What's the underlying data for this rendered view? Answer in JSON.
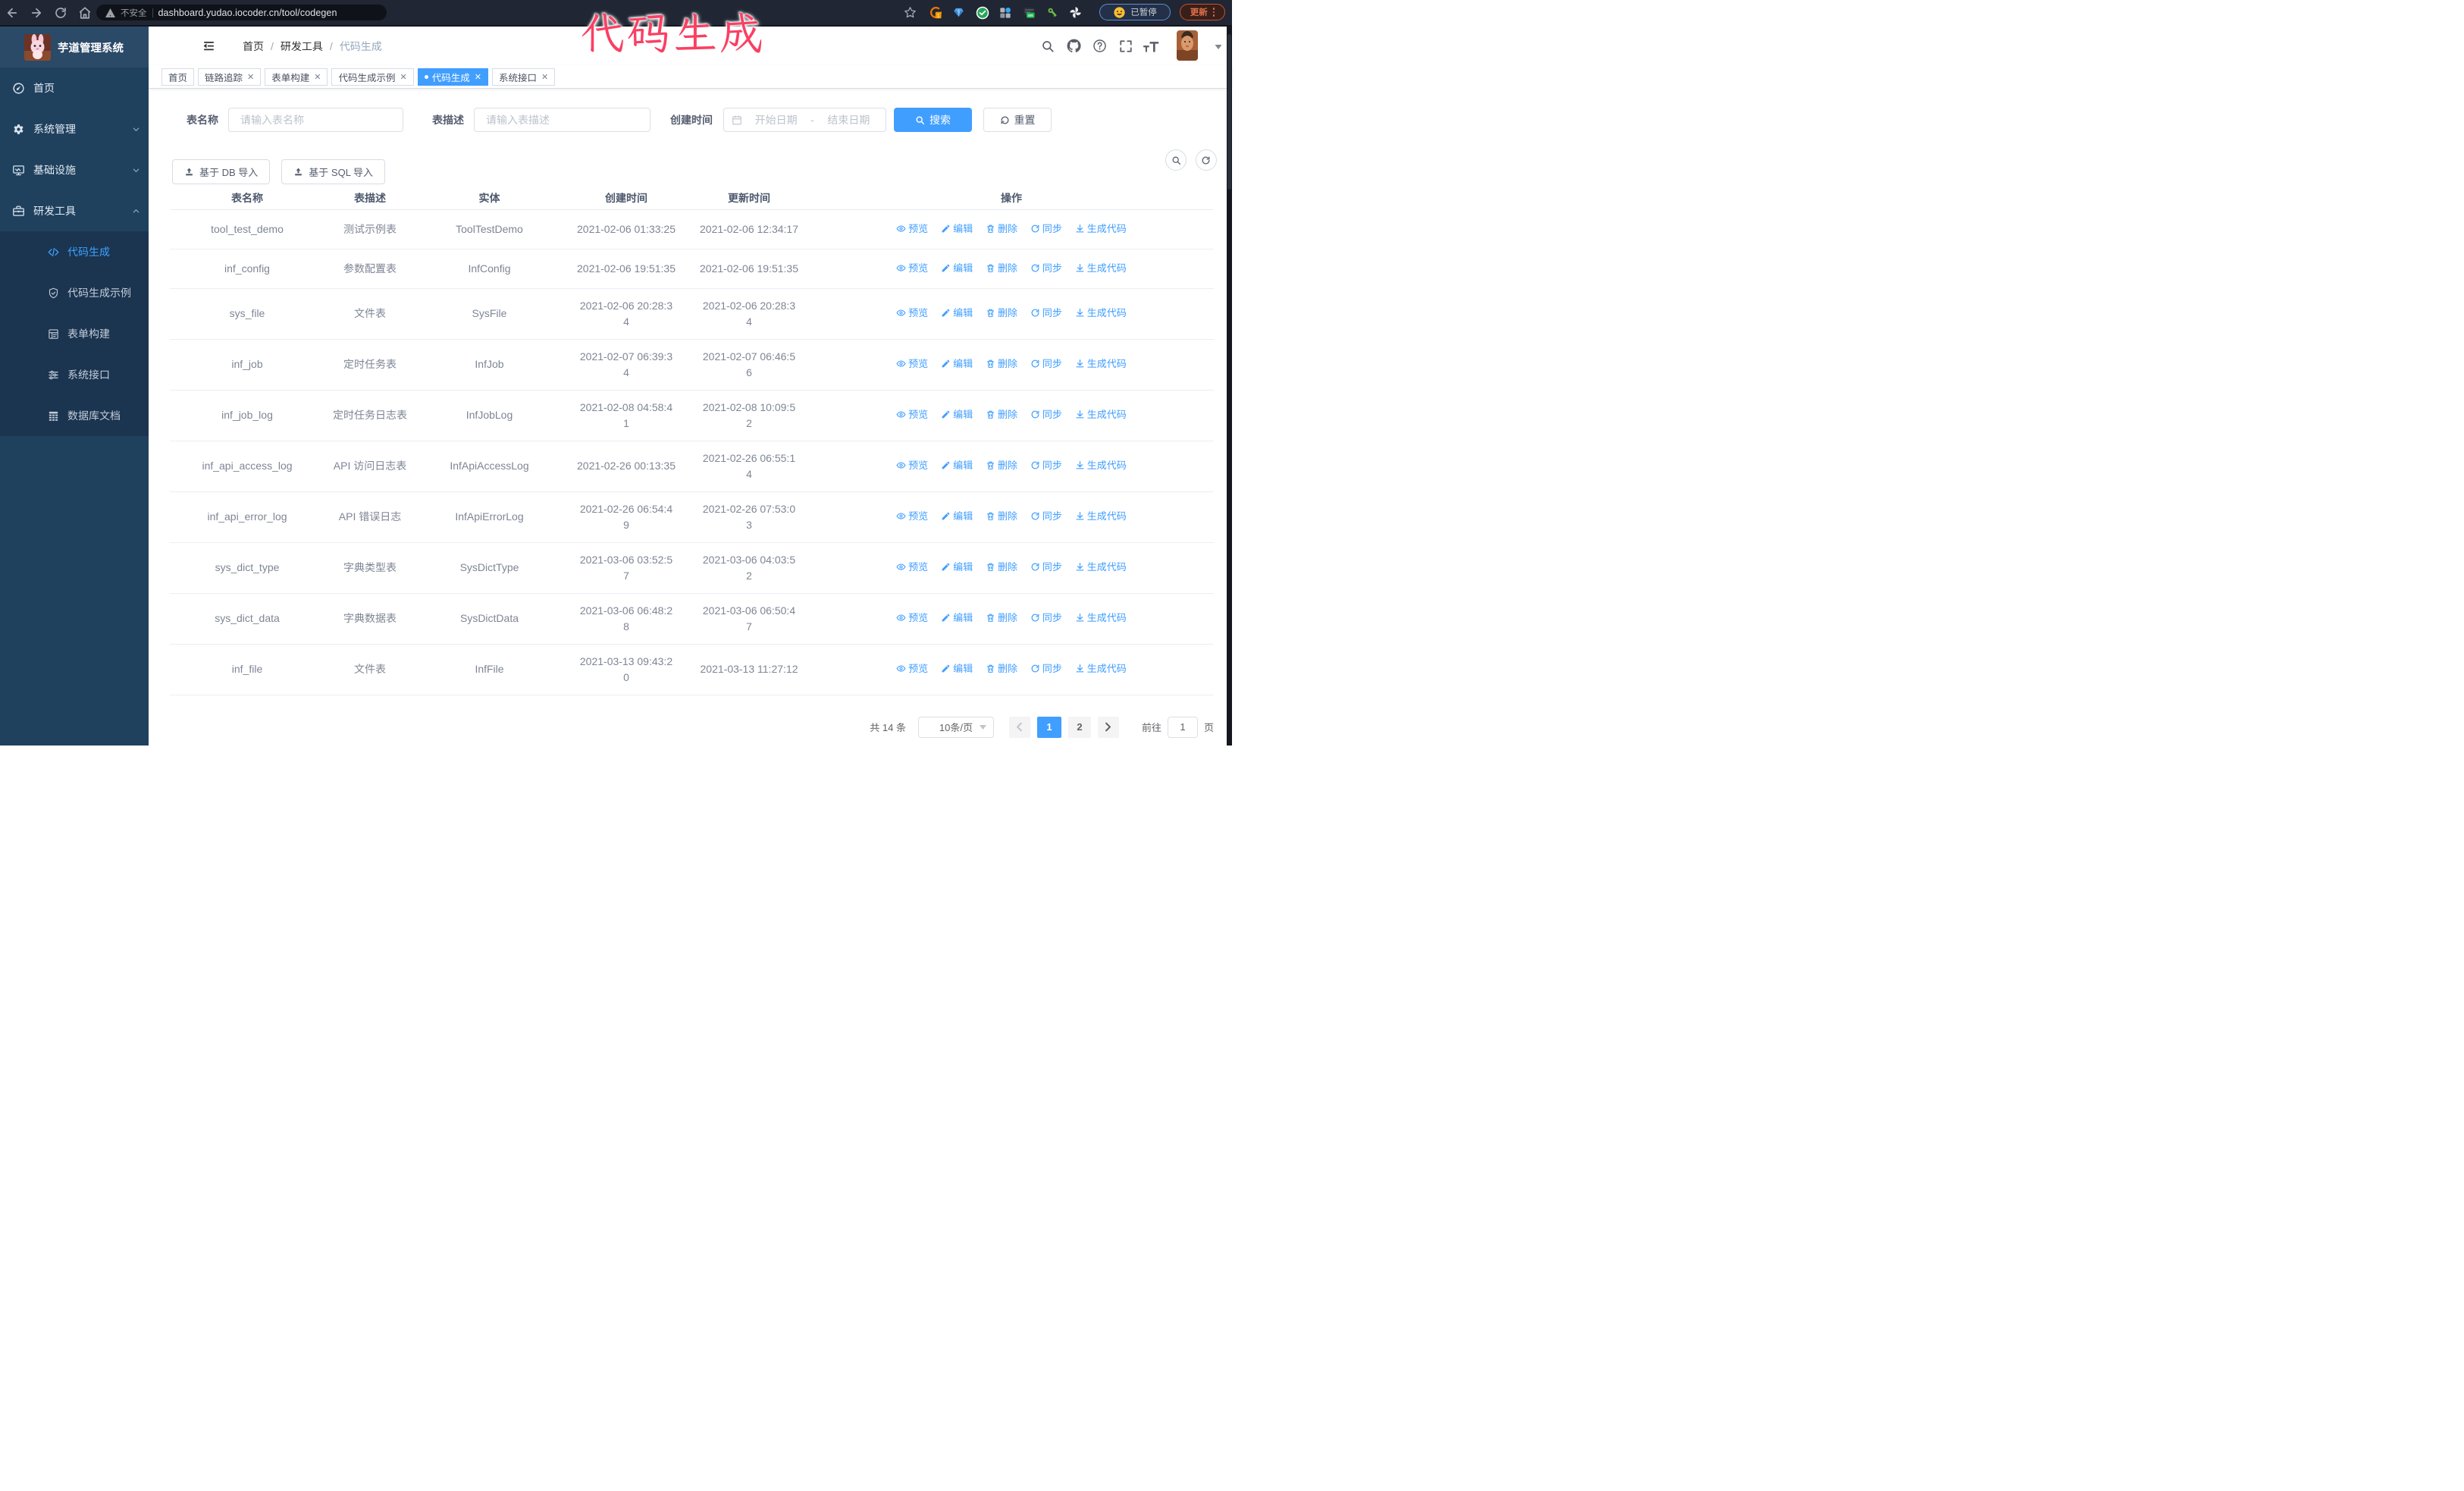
{
  "browser": {
    "security_label": "不安全",
    "url": "dashboard.yudao.iocoder.cn/tool/codegen",
    "profile_paused_label": "已暂停",
    "update_label": "更新"
  },
  "sidebar": {
    "logo_title": "芋道管理系统",
    "items": [
      {
        "label": "首页"
      },
      {
        "label": "系统管理"
      },
      {
        "label": "基础设施"
      },
      {
        "label": "研发工具"
      }
    ],
    "sub_items": [
      {
        "label": "代码生成"
      },
      {
        "label": "代码生成示例"
      },
      {
        "label": "表单构建"
      },
      {
        "label": "系统接口"
      },
      {
        "label": "数据库文档"
      }
    ]
  },
  "breadcrumb": [
    "首页",
    "研发工具",
    "代码生成"
  ],
  "tabs": [
    {
      "label": "首页",
      "active": false,
      "closable": false
    },
    {
      "label": "链路追踪",
      "active": false,
      "closable": true
    },
    {
      "label": "表单构建",
      "active": false,
      "closable": true
    },
    {
      "label": "代码生成示例",
      "active": false,
      "closable": true
    },
    {
      "label": "代码生成",
      "active": true,
      "closable": true
    },
    {
      "label": "系统接口",
      "active": false,
      "closable": true
    }
  ],
  "annotation": "代码生成",
  "filters": {
    "name_label": "表名称",
    "name_placeholder": "请输入表名称",
    "desc_label": "表描述",
    "desc_placeholder": "请输入表描述",
    "date_label": "创建时间",
    "date_start_placeholder": "开始日期",
    "date_separator": "-",
    "date_end_placeholder": "结束日期",
    "search_label": "搜索",
    "reset_label": "重置"
  },
  "toolbar": {
    "import_db_label": "基于 DB 导入",
    "import_sql_label": "基于 SQL 导入"
  },
  "table": {
    "headers": [
      "表名称",
      "表描述",
      "实体",
      "创建时间",
      "更新时间",
      "操作"
    ],
    "actions": [
      "预览",
      "编辑",
      "删除",
      "同步",
      "生成代码"
    ],
    "rows": [
      {
        "name": "tool_test_demo",
        "desc": "测试示例表",
        "entity": "ToolTestDemo",
        "created": "2021-02-06 01:33:25",
        "updated": "2021-02-06 12:34:17"
      },
      {
        "name": "inf_config",
        "desc": "参数配置表",
        "entity": "InfConfig",
        "created": "2021-02-06 19:51:35",
        "updated": "2021-02-06 19:51:35"
      },
      {
        "name": "sys_file",
        "desc": "文件表",
        "entity": "SysFile",
        "created": "2021-02-06 20:28:3\n4",
        "updated": "2021-02-06 20:28:3\n4"
      },
      {
        "name": "inf_job",
        "desc": "定时任务表",
        "entity": "InfJob",
        "created": "2021-02-07 06:39:3\n4",
        "updated": "2021-02-07 06:46:5\n6"
      },
      {
        "name": "inf_job_log",
        "desc": "定时任务日志表",
        "entity": "InfJobLog",
        "created": "2021-02-08 04:58:4\n1",
        "updated": "2021-02-08 10:09:5\n2"
      },
      {
        "name": "inf_api_access_log",
        "desc": "API 访问日志表",
        "entity": "InfApiAccessLog",
        "created": "2021-02-26 00:13:35",
        "updated": "2021-02-26 06:55:1\n4"
      },
      {
        "name": "inf_api_error_log",
        "desc": "API 错误日志",
        "entity": "InfApiErrorLog",
        "created": "2021-02-26 06:54:4\n9",
        "updated": "2021-02-26 07:53:0\n3"
      },
      {
        "name": "sys_dict_type",
        "desc": "字典类型表",
        "entity": "SysDictType",
        "created": "2021-03-06 03:52:5\n7",
        "updated": "2021-03-06 04:03:5\n2"
      },
      {
        "name": "sys_dict_data",
        "desc": "字典数据表",
        "entity": "SysDictData",
        "created": "2021-03-06 06:48:2\n8",
        "updated": "2021-03-06 06:50:4\n7"
      },
      {
        "name": "inf_file",
        "desc": "文件表",
        "entity": "InfFile",
        "created": "2021-03-13 09:43:2\n0",
        "updated": "2021-03-13 11:27:12"
      }
    ]
  },
  "pagination": {
    "total_label": "共 14 条",
    "page_size_label": "10条/页",
    "pages": [
      "1",
      "2"
    ],
    "current_page": "1",
    "goto_label": "前往",
    "goto_value": "1",
    "page_unit_label": "页"
  }
}
